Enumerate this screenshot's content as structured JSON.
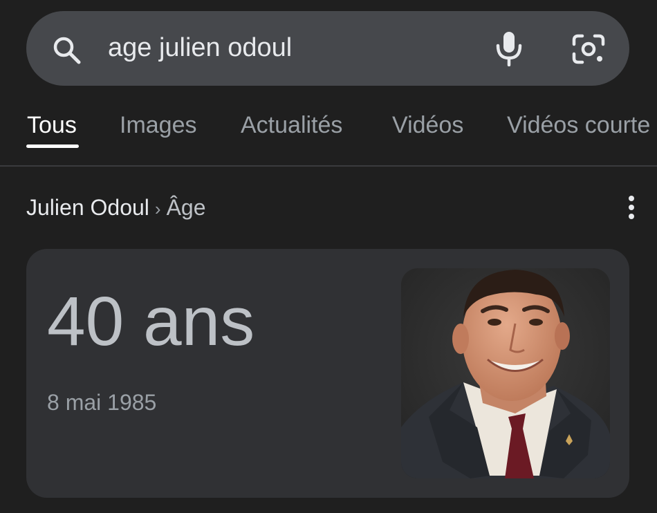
{
  "search": {
    "query": "age julien odoul",
    "icon": "search-icon",
    "voice_icon": "microphone-icon",
    "lens_icon": "lens-camera-icon"
  },
  "tabs": [
    {
      "label": "Tous",
      "active": true
    },
    {
      "label": "Images",
      "active": false
    },
    {
      "label": "Actualités",
      "active": false
    },
    {
      "label": "Vidéos",
      "active": false
    },
    {
      "label": "Vidéos courte",
      "active": false
    }
  ],
  "breadcrumb": {
    "entity": "Julien Odoul",
    "separator": "›",
    "attribute": "Âge",
    "menu_icon": "more-vert-icon"
  },
  "answer": {
    "value": "40 ans",
    "detail": "8 mai 1985"
  },
  "colors": {
    "background": "#1f1f1f",
    "search_bar": "#46484c",
    "card": "#303134",
    "text_primary": "#e8eaed",
    "text_secondary": "#9aa0a6"
  }
}
